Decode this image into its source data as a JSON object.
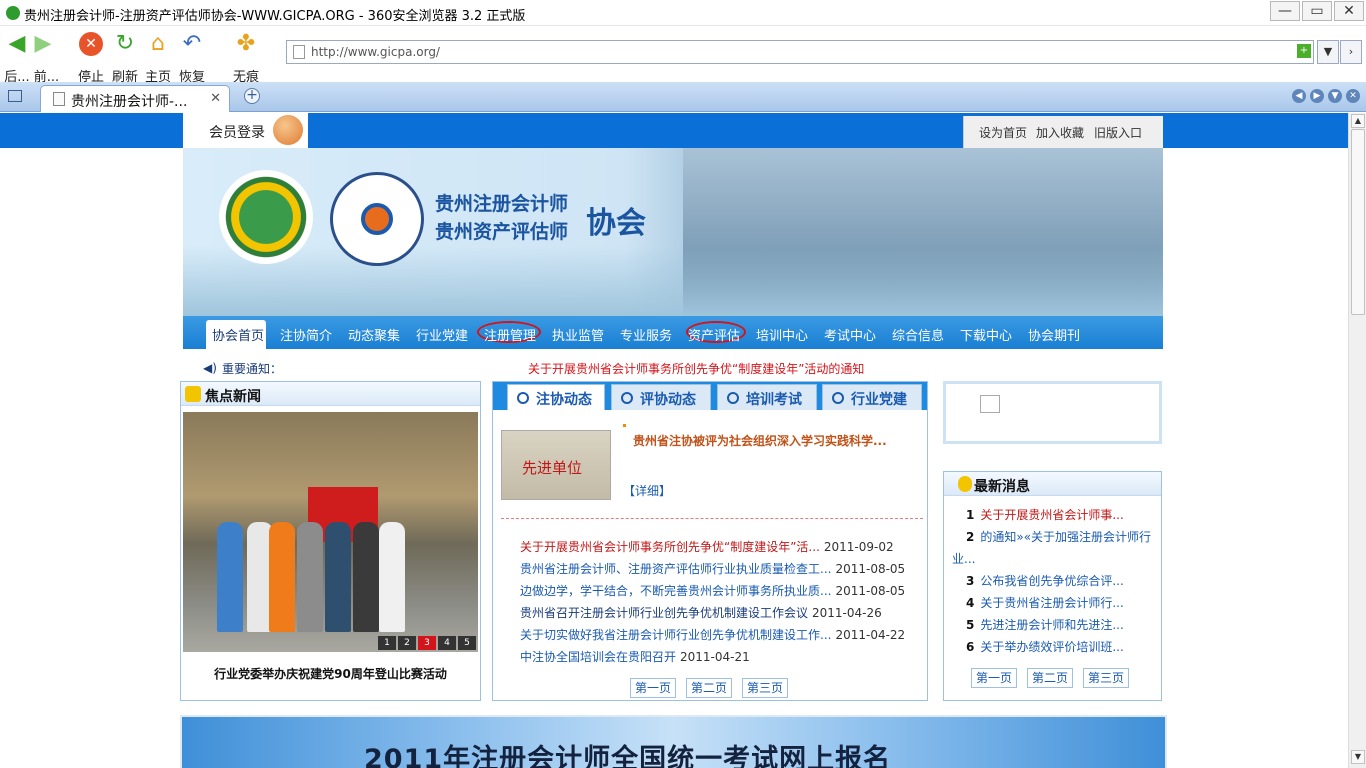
{
  "window": {
    "title": "贵州注册会计师-注册资产评估师协会-WWW.GICPA.ORG - 360安全浏览器 3.2 正式版",
    "min": "—",
    "max": "▭",
    "close": "✕"
  },
  "toolbar": {
    "back": "后...",
    "forward": "前...",
    "stop": "停止",
    "refresh": "刷新",
    "home": "主页",
    "restore": "恢复",
    "private": "无痕"
  },
  "address": {
    "url": "http://www.gicpa.org/"
  },
  "tabs": [
    {
      "label": "贵州注册会计师-...",
      "close": "✕"
    }
  ],
  "new_tab": "+",
  "site": {
    "member_login": "会员登录",
    "top_links": [
      "设为首页",
      "加入收藏",
      "旧版入口"
    ],
    "banner_line1": "贵州注册会计师",
    "banner_line2": "贵州资产评估师",
    "banner_line3": "协会",
    "nav": [
      "协会首页",
      "注协简介",
      "动态聚集",
      "行业党建",
      "注册管理",
      "执业监管",
      "专业服务",
      "资产评估",
      "培训中心",
      "考试中心",
      "综合信息",
      "下载中心",
      "协会期刊"
    ],
    "notice_label": "重要通知：",
    "notice_text": "关于开展贵州省会计师事务所创先争优“制度建设年”活动的通知",
    "focus_title": "焦点新闻",
    "photo_pages": [
      "1",
      "2",
      "3",
      "4",
      "5"
    ],
    "focus_caption": "行业党委举办庆祝建党90周年登山比赛活动",
    "news_tabs": [
      "注协动态",
      "评协动态",
      "培训考试",
      "行业党建"
    ],
    "feature_img_text": "先进单位",
    "feature_title": "贵州省注协被评为社会组织深入学习实践科学...",
    "feature_detail": "【详细】",
    "news_items": [
      {
        "title": "关于开展贵州省会计师事务所创先争优“制度建设年”活...",
        "date": "2011-09-02",
        "color": "#c01818"
      },
      {
        "title": "贵州省注册会计师、注册资产评估师行业执业质量检查工...",
        "date": "2011-08-05",
        "color": "#1a5bb0"
      },
      {
        "title": "边做边学，学干结合，不断完善贵州会计师事务所执业质...",
        "date": "2011-08-05",
        "color": "#1a5bb0"
      },
      {
        "title": "贵州省召开注册会计师行业创先争优机制建设工作会议",
        "date": "2011-04-26",
        "color": "#1a3c7a"
      },
      {
        "title": "关于切实做好我省注册会计师行业创先争优机制建设工作...",
        "date": "2011-04-22",
        "color": "#1a5bb0"
      },
      {
        "title": "中注协全国培训会在贵阳召开",
        "date": "2011-04-21",
        "color": "#1a5bb0"
      }
    ],
    "pages": [
      "第一页",
      "第二页",
      "第三页"
    ],
    "latest_title": "最新消息",
    "latest_items": [
      {
        "num": "1",
        "text": "关于开展贵州省会计师事..."
      },
      {
        "num": "2",
        "text": "的通知»«关于加强注册会计师行"
      },
      {
        "num": "",
        "text": "业..."
      },
      {
        "num": "3",
        "text": "公布我省创先争优综合评..."
      },
      {
        "num": "4",
        "text": "关于贵州省注册会计师行..."
      },
      {
        "num": "5",
        "text": "先进注册会计师和先进注..."
      },
      {
        "num": "6",
        "text": "关于举办绩效评价培训班..."
      }
    ],
    "exam_banner": "2011年注册会计师全国统一考试网上报名"
  }
}
